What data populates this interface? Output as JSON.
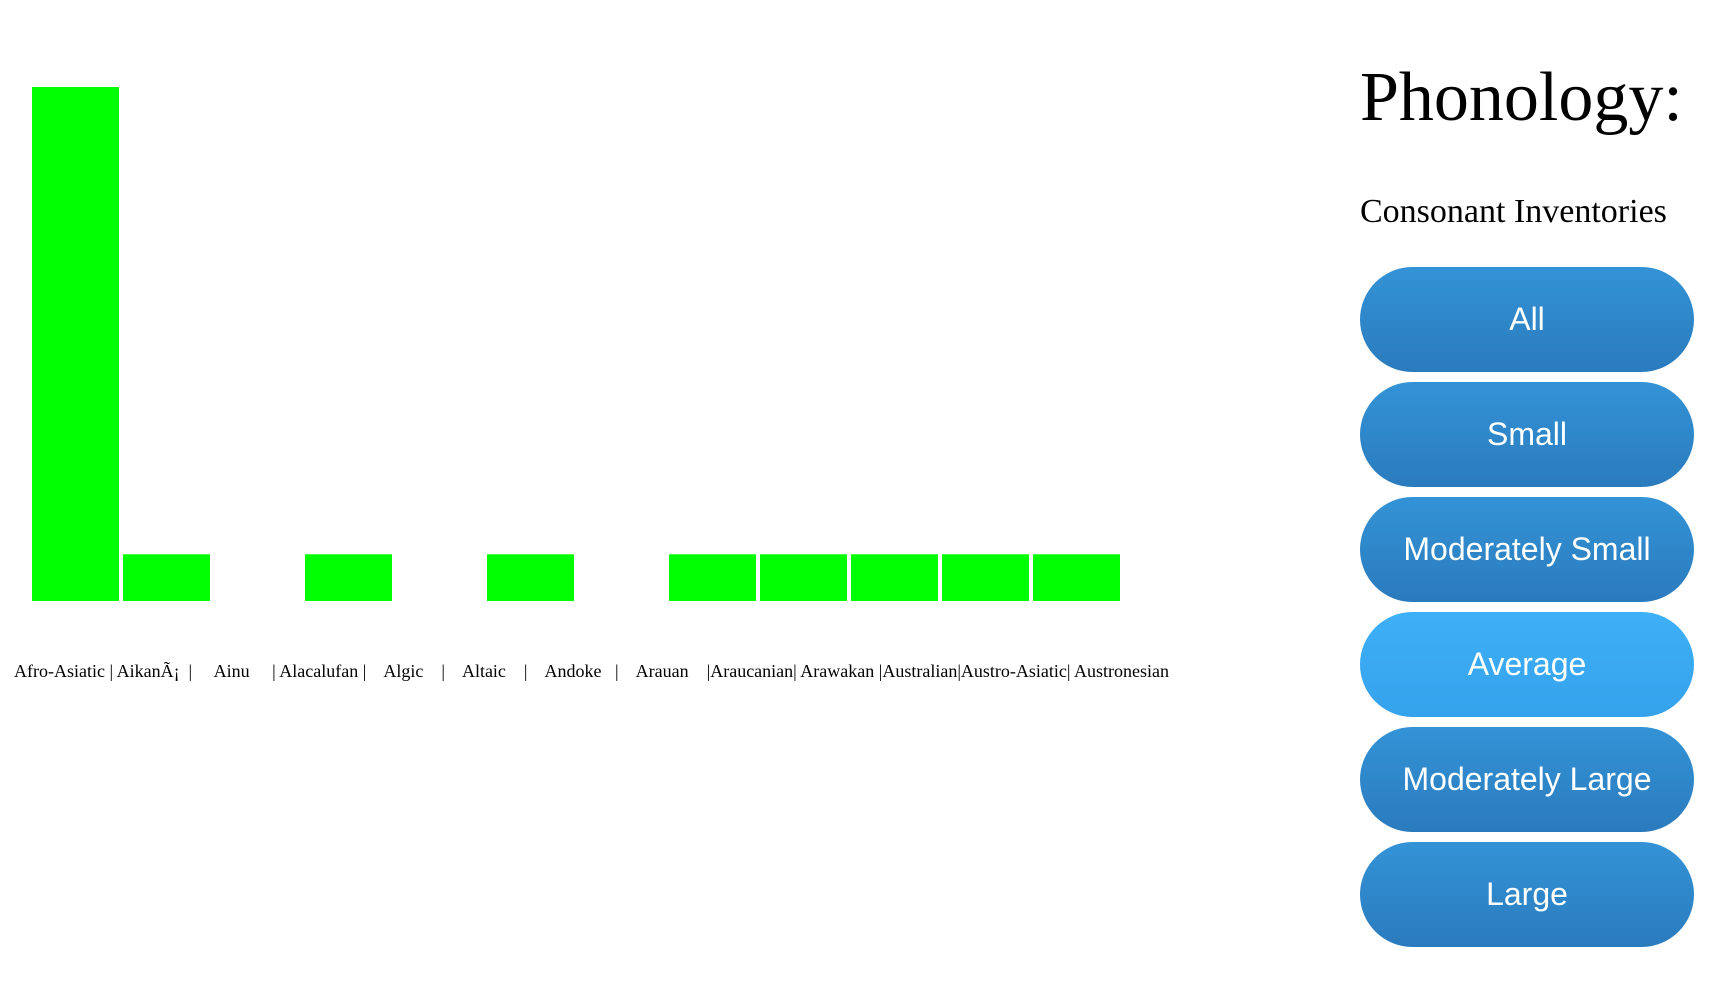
{
  "sidebar": {
    "title": "Phonology:",
    "subtitle": "Consonant Inventories",
    "buttons": [
      {
        "label": "All",
        "active": false
      },
      {
        "label": "Small",
        "active": false
      },
      {
        "label": "Moderately Small",
        "active": false
      },
      {
        "label": "Average",
        "active": true
      },
      {
        "label": "Moderately Large",
        "active": false
      },
      {
        "label": "Large",
        "active": false
      }
    ]
  },
  "chart_data": {
    "type": "bar",
    "title": "",
    "xlabel": "",
    "ylabel": "",
    "bar_color": "#00ff00",
    "categories": [
      "Afro-Asiatic",
      "AikanÃ¡",
      "Ainu",
      "Alacalufan",
      "Algic",
      "Altaic",
      "Andoke",
      "Arauan",
      "Araucanian",
      "Arawakan",
      "Australian",
      "Austro-Asiatic",
      "Austronesian"
    ],
    "values": [
      11,
      1,
      0,
      1,
      0,
      1,
      0,
      1,
      1,
      1,
      1,
      1,
      0
    ],
    "ylim": [
      0,
      11
    ],
    "tick_labels_text": "Afro-Asiatic | AikanÃ¡  |     Ainu     | Alacalufan |    Algic    |    Altaic    |    Andoke   |    Arauan    |Araucanian| Arawakan |Australian|Austro-Asiatic| Austronesian",
    "grid": false,
    "legend": "none"
  }
}
